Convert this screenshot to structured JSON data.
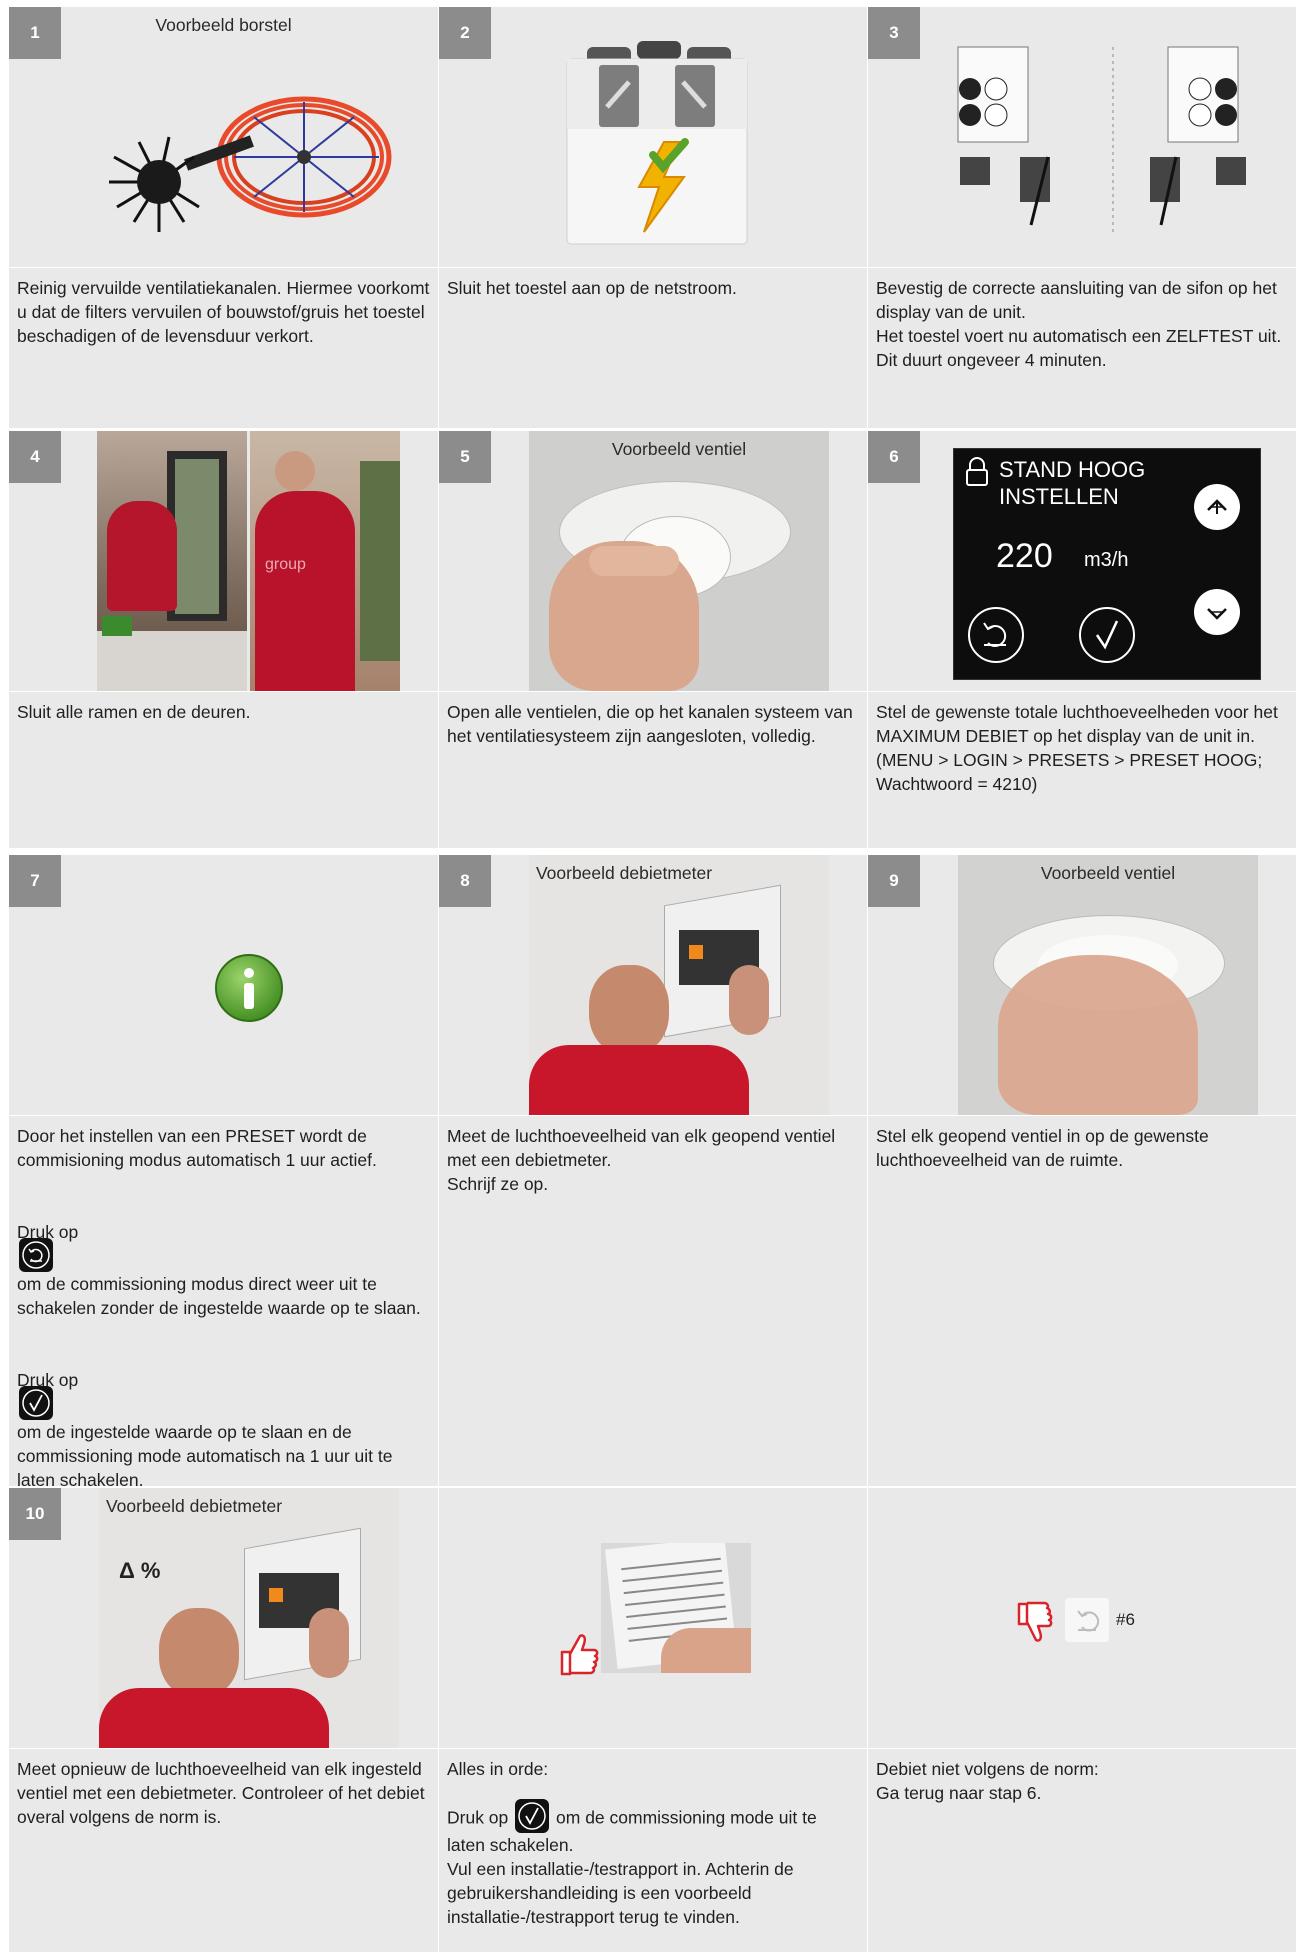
{
  "cells": {
    "c1": {
      "num": "1",
      "caption": "Voorbeeld borstel",
      "text": "Reinig vervuilde ventilatiekanalen. Hiermee voorkomt u dat de filters vervuilen of bouwstof/gruis het toestel beschadigen of de levensduur verkort."
    },
    "c2": {
      "num": "2",
      "text": "Sluit het toestel aan op de netstroom."
    },
    "c3": {
      "num": "3",
      "text": "Bevestig de correcte aansluiting van de sifon op het display van de unit.\nHet toestel voert nu automatisch een ZELFTEST uit. Dit duurt ongeveer 4 minuten."
    },
    "c4": {
      "num": "4",
      "photo_text": "group",
      "text": "Sluit alle ramen en de deuren."
    },
    "c5": {
      "num": "5",
      "caption": "Voorbeeld ventiel",
      "text": "Open alle ventielen, die op het kanalen systeem van het ventilatiesysteem zijn aangesloten, volledig."
    },
    "c6": {
      "num": "6",
      "display_line1": "STAND HOOG",
      "display_line2": "INSTELLEN",
      "display_value": "220",
      "display_unit": "m3/h",
      "text": "Stel de gewenste totale luchthoeveelheden voor het MAXIMUM DEBIET op het display van de unit in. (MENU > LOGIN > PRESETS > PRESET HOOG; Wachtwoord = 4210)"
    },
    "c7": {
      "num": "7",
      "p1": "Door het instellen van een PRESET wordt de commisioning modus automatisch 1 uur actief.",
      "p2_pre": "Druk op",
      "p2_post": "om de commissioning modus direct weer uit te schakelen zonder de ingestelde waarde op te slaan.",
      "p3_pre": "Druk op",
      "p3_post": "om de ingestelde waarde op te slaan en de commissioning mode automatisch na 1 uur uit te laten schakelen."
    },
    "c8": {
      "num": "8",
      "caption": "Voorbeeld debietmeter",
      "text": "Meet de luchthoeveelheid van elk geopend ventiel met een debietmeter.\nSchrijf ze op."
    },
    "c9": {
      "num": "9",
      "caption": "Voorbeeld ventiel",
      "text": "Stel elk geopend ventiel in op de gewenste luchthoeveelheid van de ruimte."
    },
    "c10": {
      "num": "10",
      "caption": "Voorbeeld debietmeter",
      "delta": "Δ %",
      "text": "Meet opnieuw de luchthoeveelheid van elk ingesteld ventiel met een debietmeter. Controleer of het debiet overal volgens de norm is."
    },
    "c11": {
      "p1": "Alles in orde:",
      "p2_pre": "Druk op",
      "p2_post": "om de commissioning mode uit te laten schakelen.\nVul een installatie-/testrapport in. Achterin de gebruikershandleiding is een voorbeeld installatie-/testrapport terug te vinden."
    },
    "c12": {
      "ref": "#6",
      "text": "Debiet niet volgens de norm:\nGa  terug naar stap 6."
    }
  }
}
